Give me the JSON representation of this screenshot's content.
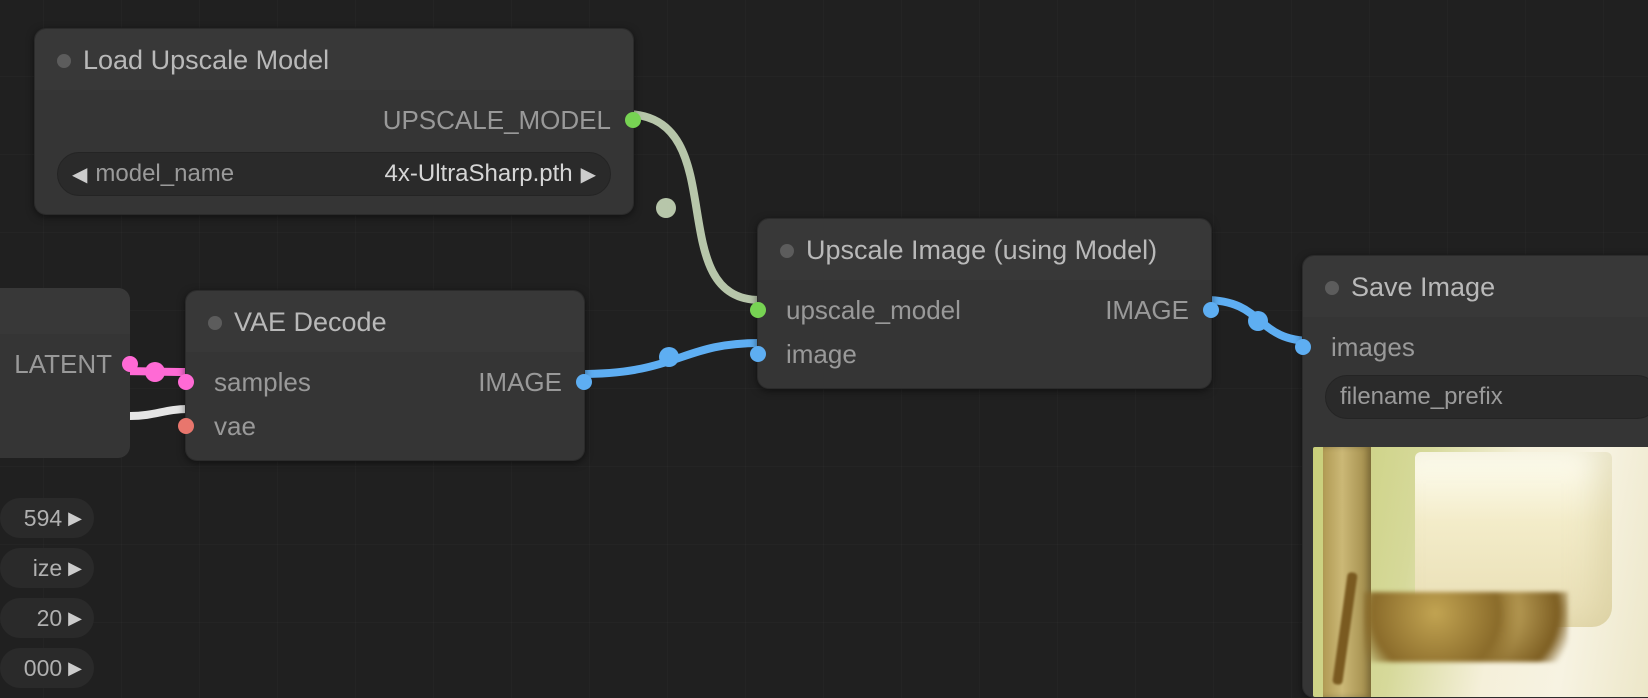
{
  "nodes": {
    "load_upscale_model": {
      "title": "Load Upscale Model",
      "outputs": {
        "upscale_model": "UPSCALE_MODEL"
      },
      "widgets": {
        "model_name": {
          "label": "model_name",
          "value": "4x-UltraSharp.pth"
        }
      }
    },
    "vae_decode": {
      "title": "VAE Decode",
      "inputs": {
        "samples": "samples",
        "vae": "vae"
      },
      "outputs": {
        "image": "IMAGE"
      }
    },
    "upscale_image": {
      "title": "Upscale Image (using Model)",
      "inputs": {
        "upscale_model": "upscale_model",
        "image": "image"
      },
      "outputs": {
        "image": "IMAGE"
      }
    },
    "save_image": {
      "title": "Save Image",
      "inputs": {
        "images": "images"
      },
      "widgets": {
        "filename_prefix": {
          "label": "filename_prefix"
        }
      }
    },
    "partial_left_a": {
      "outputs": {
        "latent": "LATENT"
      }
    },
    "partial_left_b": {
      "widgets": {
        "w1": {
          "value": "594"
        },
        "w2": {
          "value": "ize"
        },
        "w3": {
          "value": "20"
        },
        "w4": {
          "value": "000"
        }
      }
    }
  },
  "colors": {
    "green": "#77d353",
    "blue": "#5eaef2",
    "pink": "#ff6ad5",
    "salmon": "#e8766d"
  }
}
